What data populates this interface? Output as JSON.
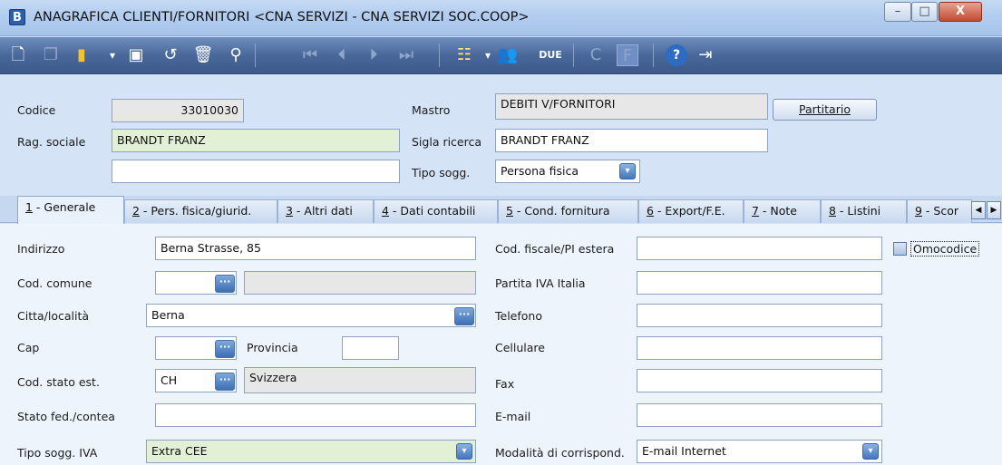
{
  "window": {
    "app_icon": "B",
    "title": "ANAGRAFICA CLIENTI/FORNITORI <CNA SERVIZI - CNA SERVIZI SOC.COOP>",
    "controls": {
      "minimize": "–",
      "maximize": "□",
      "close": "X"
    }
  },
  "toolbar": {
    "icons": [
      "new-icon",
      "copy-icon",
      "folder-icon",
      "save-icon",
      "undo-icon",
      "delete-icon",
      "find-icon",
      "first-record-icon",
      "previous-record-icon",
      "next-record-icon",
      "last-record-icon",
      "list-icon",
      "users-icon",
      "due-icon",
      "c-icon",
      "f-icon",
      "help-icon",
      "exit-icon"
    ],
    "due_label": "DUE",
    "c_label": "C",
    "f_label": "F"
  },
  "header": {
    "codice_label": "Codice",
    "codice_value": "33010030",
    "mastro_label": "Mastro",
    "mastro_value": "DEBITI V/FORNITORI",
    "partitario_button": "Partitario",
    "rag_sociale_label": "Rag. sociale",
    "rag_sociale_value": "BRANDT FRANZ",
    "sigla_ricerca_label": "Sigla ricerca",
    "sigla_ricerca_value": "BRANDT FRANZ",
    "rag_sociale_2_value": "",
    "tipo_sogg_label": "Tipo sogg.",
    "tipo_sogg_value": "Persona fisica"
  },
  "tabs": [
    {
      "num": "1",
      "label": " - Generale"
    },
    {
      "num": "2",
      "label": " - Pers. fisica/giurid."
    },
    {
      "num": "3",
      "label": " - Altri dati"
    },
    {
      "num": "4",
      "label": " - Dati contabili"
    },
    {
      "num": "5",
      "label": " - Cond. fornitura"
    },
    {
      "num": "6",
      "label": " - Export/F.E."
    },
    {
      "num": "7",
      "label": " - Note"
    },
    {
      "num": "8",
      "label": " - Listini"
    },
    {
      "num": "9",
      "label": " - Scor"
    }
  ],
  "general": {
    "indirizzo_label": "Indirizzo",
    "indirizzo_value": "Berna Strasse, 85",
    "cod_comune_label": "Cod. comune",
    "cod_comune_value": "",
    "comune_desc_value": "",
    "citta_label": "Citta/località",
    "citta_value": "Berna",
    "cap_label": "Cap",
    "cap_value": "",
    "provincia_label": "Provincia",
    "provincia_value": "",
    "cod_stato_label": "Cod. stato est.",
    "cod_stato_value": "CH",
    "stato_desc_value": "Svizzera",
    "stato_fed_label": "Stato fed./contea",
    "stato_fed_value": "",
    "tipo_sogg_iva_label": "Tipo sogg. IVA",
    "tipo_sogg_iva_value": "Extra CEE",
    "cod_fiscale_label": "Cod. fiscale/PI estera",
    "cod_fiscale_value": "",
    "omocodice_label": "Omocodice",
    "partita_iva_label": "Partita IVA Italia",
    "partita_iva_value": "",
    "telefono_label": "Telefono",
    "telefono_value": "",
    "cellulare_label": "Cellulare",
    "cellulare_value": "",
    "fax_label": "Fax",
    "fax_value": "",
    "email_label": "E-mail",
    "email_value": "",
    "modalita_label": "Modalità di corrispond.",
    "modalita_value": "E-mail Internet"
  },
  "glyphs": {
    "ellipsis": "···",
    "chevron": "▾",
    "left": "◀",
    "right": "▶"
  }
}
